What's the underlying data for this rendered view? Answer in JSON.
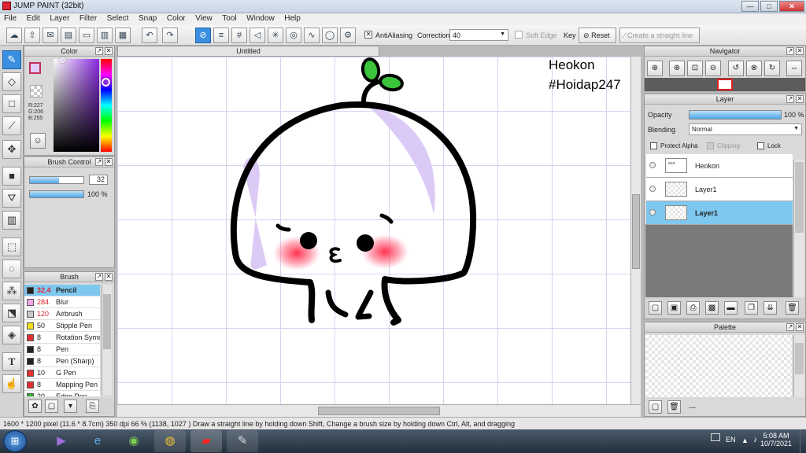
{
  "window": {
    "title": "JUMP PAINT (32bit)"
  },
  "menu": [
    "File",
    "Edit",
    "Layer",
    "Filter",
    "Select",
    "Snap",
    "Color",
    "View",
    "Tool",
    "Window",
    "Help"
  ],
  "toolbar": {
    "antialiasing_label": "AntiAliasing",
    "correction_label": "Correction",
    "correction_value": "40",
    "soft_edge_label": "Soft Edge",
    "key_label": "Key",
    "reset_label": "Reset",
    "straight_line_label": "Create a straight line"
  },
  "color_panel": {
    "title": "Color",
    "r": "R:227",
    "g": "G:206",
    "b": "B:255",
    "primary_color": "#e3ceff"
  },
  "brush_control": {
    "title": "Brush Control",
    "size": "32",
    "opacity": "100 %",
    "size_fraction": 0.55,
    "opacity_fraction": 1.0
  },
  "brush_panel": {
    "title": "Brush",
    "items": [
      {
        "size": "32.4",
        "name": "Pencil",
        "color": "#222222",
        "selected": true
      },
      {
        "size": "284",
        "name": "Blur",
        "color": "#f2a6e6"
      },
      {
        "size": "120",
        "name": "Airbrush",
        "color": "#c8c8c8"
      },
      {
        "size": "50",
        "name": "Stipple Pen",
        "color": "#f0e020"
      },
      {
        "size": "8",
        "name": "Rotation Symm",
        "color": "#e03030"
      },
      {
        "size": "8",
        "name": "Pen",
        "color": "#222222"
      },
      {
        "size": "8",
        "name": "Pen (Sharp)",
        "color": "#222222"
      },
      {
        "size": "10",
        "name": "G Pen",
        "color": "#e03030"
      },
      {
        "size": "8",
        "name": "Mapping Pen",
        "color": "#e03030"
      },
      {
        "size": "20",
        "name": "Edge Pen",
        "color": "#30b030"
      }
    ]
  },
  "canvas": {
    "tab": "Untitled",
    "text_line1": "Heokon",
    "text_line2": "#Hoidap247"
  },
  "navigator": {
    "title": "Navigator"
  },
  "layer_panel": {
    "title": "Layer",
    "opacity_label": "Opacity",
    "opacity_value": "100 %",
    "blending_label": "Blending",
    "blending_value": "Normal",
    "protect_alpha": "Protect Alpha",
    "clipping": "Clipping",
    "lock": "Lock",
    "layers": [
      {
        "name": "Heokon",
        "selected": false
      },
      {
        "name": "Layer1",
        "selected": false
      },
      {
        "name": "Layer1",
        "selected": true
      }
    ]
  },
  "palette": {
    "title": "Palette",
    "dashes": "---"
  },
  "status": {
    "text": "1600 * 1200 pixel   (11.6 * 8.7cm)  350 dpi   66 %   (1138, 1027 )   Draw a straight line by holding down Shift, Change a brush size by holding down Ctrl, Alt, and dragging"
  },
  "taskbar": {
    "lang": "EN",
    "time": "5:08 AM",
    "date": "10/7/2021"
  }
}
